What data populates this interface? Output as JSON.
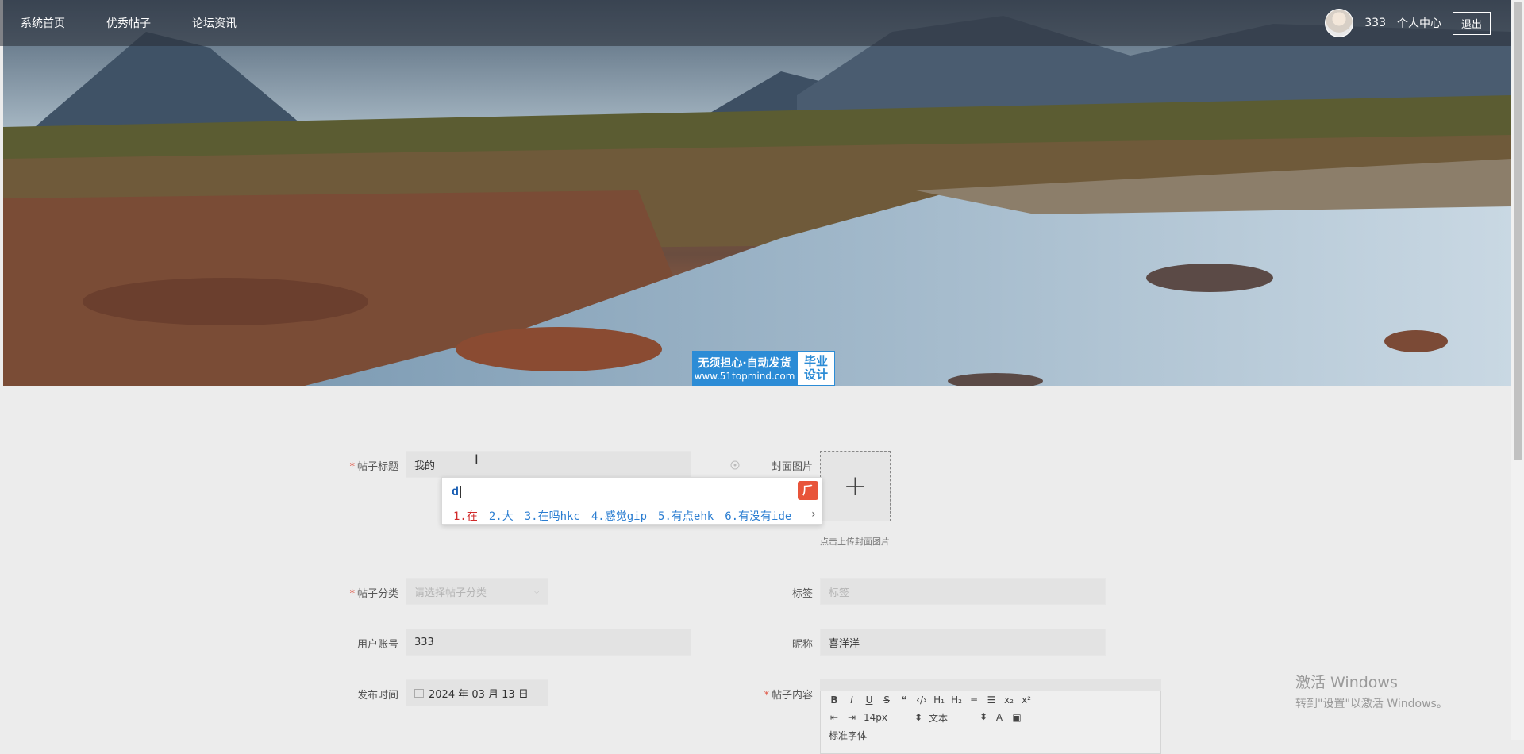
{
  "nav": {
    "items": [
      "系统首页",
      "优秀帖子",
      "论坛资讯"
    ],
    "username": "333",
    "profile_label": "个人中心",
    "logout_label": "退出"
  },
  "banner": {
    "badge_line1": "无须担心·自动发货",
    "badge_line2": "www.51topmind.com",
    "badge_right1": "毕业",
    "badge_right2": "设计"
  },
  "form": {
    "title_label": "帖子标题",
    "title_value": "我的",
    "cover_label": "封面图片",
    "cover_tip": "点击上传封面图片",
    "category_label": "帖子分类",
    "category_placeholder": "请选择帖子分类",
    "tags_label": "标签",
    "tags_placeholder": "标签",
    "account_label": "用户账号",
    "account_value": "333",
    "nickname_label": "昵称",
    "nickname_value": "喜洋洋",
    "time_label": "发布时间",
    "time_value": "2024 年 03 月 13 日",
    "content_label": "帖子内容"
  },
  "ime": {
    "composition": "d",
    "candidates": [
      "1.在",
      "2.大",
      "3.在吗hkc",
      "4.感觉gip",
      "5.有点ehk",
      "6.有没有ide"
    ]
  },
  "editor": {
    "font_size": "14px",
    "block_type": "文本",
    "row3_label": "标准字体"
  },
  "windows_watermark": {
    "line1": "激活 Windows",
    "line2": "转到\"设置\"以激活 Windows。"
  }
}
